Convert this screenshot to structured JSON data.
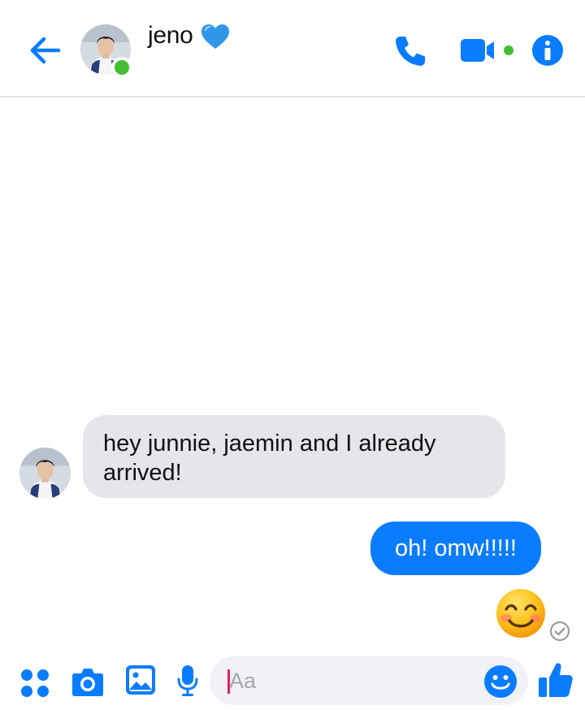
{
  "header": {
    "contact_name": "jeno",
    "name_emoji": "blue-heart",
    "presence": "online",
    "icons": [
      "back-arrow-icon",
      "phone-icon",
      "video-camera-icon",
      "info-icon"
    ]
  },
  "messages": [
    {
      "direction": "incoming",
      "text": "hey junnie, jaemin and I already arrived!"
    },
    {
      "direction": "outgoing",
      "text": "oh! omw!!!!!"
    },
    {
      "direction": "outgoing",
      "type": "emoji",
      "emoji": "smiling-face-with-smiling-eyes"
    }
  ],
  "status": {
    "seen_icon": "check-circle-icon"
  },
  "composer": {
    "placeholder": "Aa",
    "icons": [
      "apps-icon",
      "camera-icon",
      "gallery-icon",
      "microphone-icon",
      "emoji-icon",
      "thumbs-up-icon"
    ]
  },
  "colors": {
    "accent": "#0a7cff",
    "incoming_bubble": "#e4e6eb",
    "presence_dot": "#44bd32",
    "composer_bg": "#f0f2f5"
  }
}
